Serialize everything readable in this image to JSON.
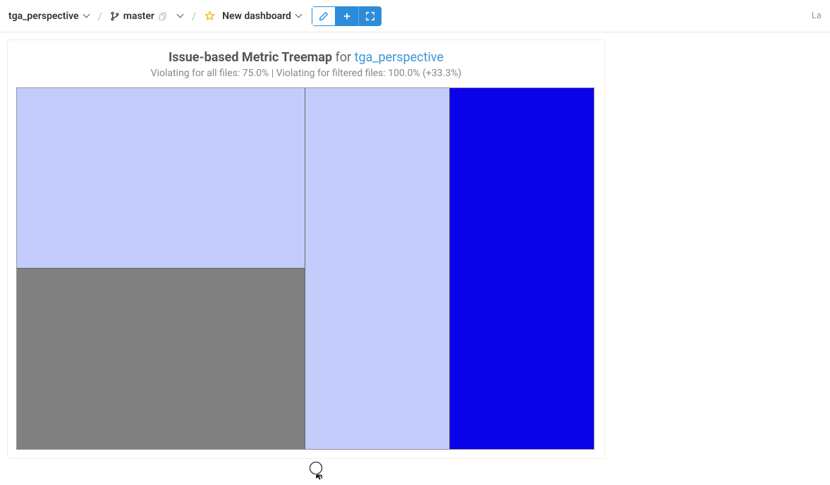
{
  "breadcrumb": {
    "project": "tga_perspective",
    "branch": "master",
    "dashboard": "New dashboard"
  },
  "topbar_right": "La",
  "card": {
    "title_strong": "Issue-based Metric Treemap",
    "title_for": " for ",
    "title_link": "tga_perspective",
    "subtitle": "Violating for all files: 75.0% | Violating for filtered files: 100.0% (+33.3%)"
  },
  "chart_data": {
    "type": "treemap",
    "title": "Issue-based Metric Treemap for tga_perspective",
    "cells": [
      {
        "id": "top-left",
        "color": "#c3ccfa",
        "relative_area": 0.25,
        "label": ""
      },
      {
        "id": "bottom-left",
        "color": "#808080",
        "relative_area": 0.25,
        "label": ""
      },
      {
        "id": "middle",
        "color": "#c3ccfa",
        "relative_area": 0.25,
        "label": ""
      },
      {
        "id": "right",
        "color": "#0a02e8",
        "relative_area": 0.25,
        "label": ""
      }
    ],
    "violating_all_files_pct": 75.0,
    "violating_filtered_files_pct": 100.0,
    "delta_pct": 33.3
  }
}
